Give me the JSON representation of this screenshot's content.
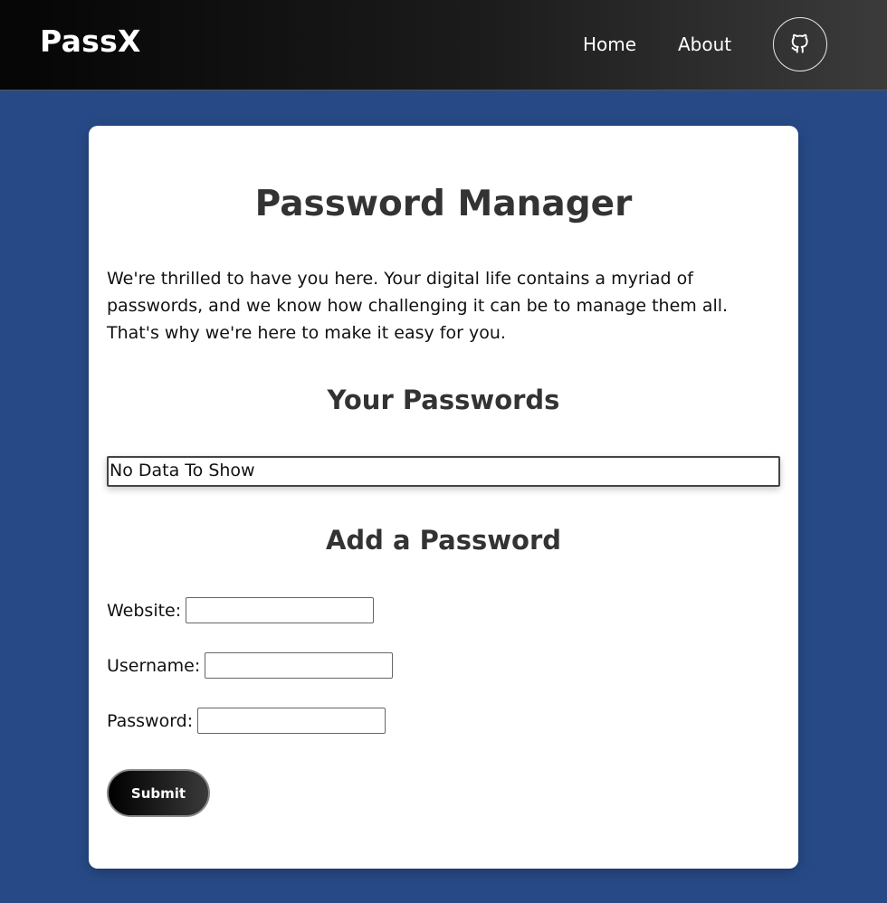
{
  "navbar": {
    "brand": "PassX",
    "links": [
      {
        "label": "Home"
      },
      {
        "label": "About"
      }
    ],
    "github_icon": "github-icon"
  },
  "main": {
    "title": "Password Manager",
    "intro": "We're thrilled to have you here. Your digital life contains a myriad of passwords, and we know how challenging it can be to manage them all. That's why we're here to make it easy for you.",
    "passwords_section": {
      "title": "Your Passwords",
      "empty_message": "No Data To Show"
    },
    "add_section": {
      "title": "Add a Password",
      "fields": [
        {
          "label": "Website:",
          "value": ""
        },
        {
          "label": "Username:",
          "value": ""
        },
        {
          "label": "Password:",
          "value": ""
        }
      ],
      "submit_label": "Submit"
    }
  },
  "colors": {
    "background": "#274a87",
    "navbar_start": "#050505",
    "navbar_end": "#3b3b3b",
    "card": "#ffffff"
  }
}
